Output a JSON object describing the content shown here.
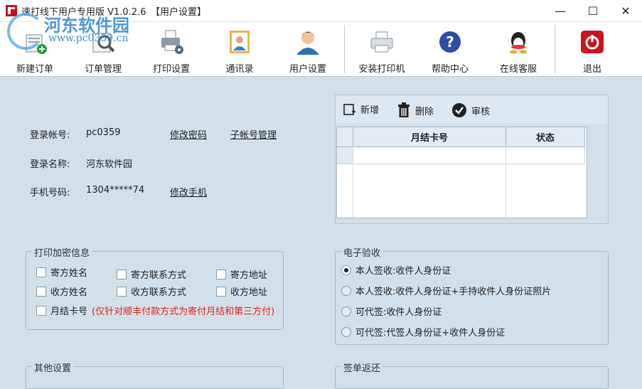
{
  "window": {
    "title": "速打线下用户专用版 V1.0.2.6",
    "subtitle": "【用户设置】",
    "minimize": "—",
    "maximize": "☐",
    "close": "✕"
  },
  "watermark": {
    "line1": "河东软件园",
    "line2": "www.pc0359.cn"
  },
  "toolbar": {
    "items": [
      {
        "label": "新建订单",
        "icon": "new-order-icon"
      },
      {
        "label": "订单管理",
        "icon": "order-search-icon"
      },
      {
        "label": "打印设置",
        "icon": "print-settings-icon"
      },
      {
        "label": "通讯录",
        "icon": "contacts-icon"
      },
      {
        "label": "用户设置",
        "icon": "user-icon"
      },
      {
        "label": "安装打印机",
        "icon": "printer-icon"
      },
      {
        "label": "帮助中心",
        "icon": "help-icon"
      },
      {
        "label": "在线客服",
        "icon": "qq-icon"
      },
      {
        "label": "退出",
        "icon": "power-icon"
      }
    ]
  },
  "account": {
    "login_label": "登录帐号:",
    "login_value": "pc0359",
    "change_password": "修改密码",
    "sub_accounts": "子帐号管理",
    "name_label": "登录名称:",
    "name_value": "河东软件园",
    "phone_label": "手机号码:",
    "phone_value": "1304*****74",
    "change_phone": "修改手机"
  },
  "grid": {
    "add": "新增",
    "delete": "删除",
    "review": "审核",
    "columns": [
      "月结卡号",
      "状态"
    ]
  },
  "print_privacy": {
    "title": "打印加密信息",
    "options": [
      "寄方姓名",
      "寄方联系方式",
      "寄方地址",
      "收方姓名",
      "收方联系方式",
      "收方地址"
    ],
    "monthly": "月结卡号",
    "monthly_note": "(仅针对顺丰付款方式为寄付月结和第三方付)"
  },
  "e_sign": {
    "title": "电子验收",
    "options": [
      {
        "label": "本人签收:收件人身份证",
        "selected": true
      },
      {
        "label": "本人签收:收件人身份证+手持收件人身份证照片",
        "selected": false
      },
      {
        "label": "可代签:收件人身份证",
        "selected": false
      },
      {
        "label": "可代签:代签人身份证+收件人身份证",
        "selected": false
      }
    ]
  },
  "other": {
    "title": "其他设置"
  },
  "return_sign": {
    "title": "签单返还"
  }
}
